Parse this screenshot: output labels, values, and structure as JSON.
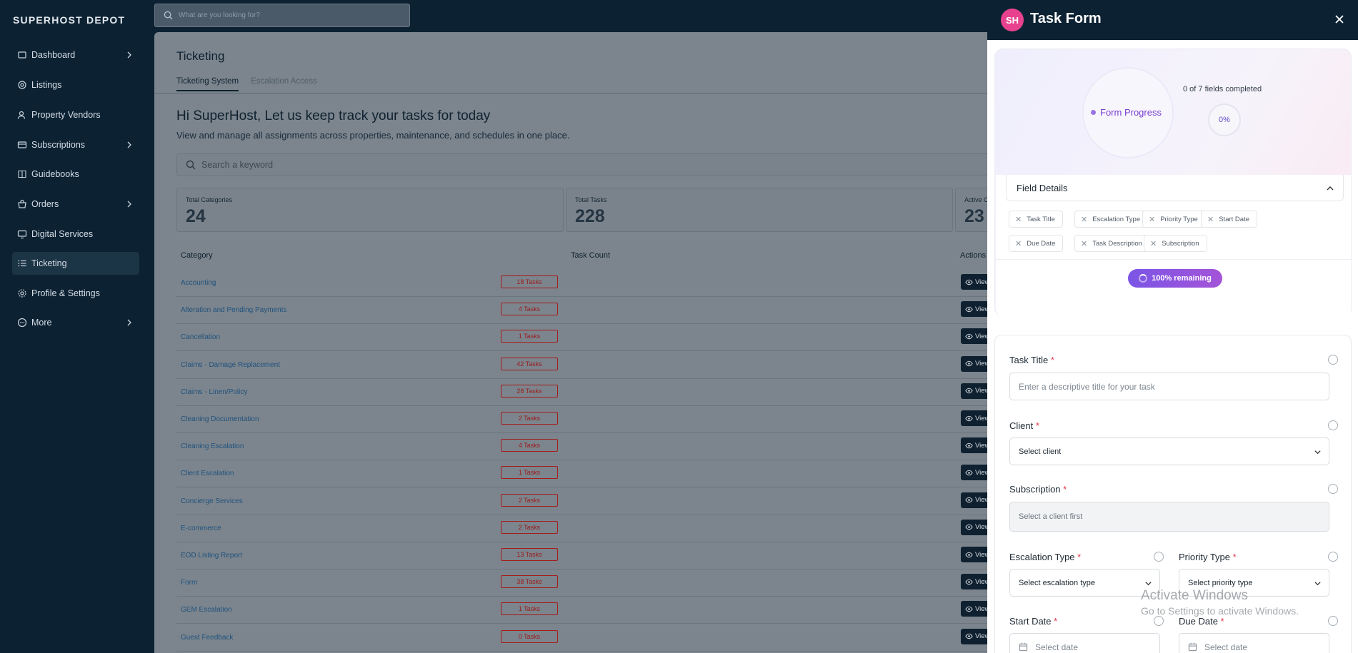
{
  "brand": "SUPERHOST DEPOT",
  "top_search": {
    "placeholder": "What are you looking for?"
  },
  "sidebar": {
    "items": [
      {
        "label": "Dashboard",
        "icon": "dashboard-icon",
        "has_chevron": true
      },
      {
        "label": "Listings",
        "icon": "listings-icon",
        "has_chevron": false
      },
      {
        "label": "Property Vendors",
        "icon": "vendors-icon",
        "has_chevron": false
      },
      {
        "label": "Subscriptions",
        "icon": "subscriptions-icon",
        "has_chevron": true
      },
      {
        "label": "Guidebooks",
        "icon": "book-icon",
        "has_chevron": false
      },
      {
        "label": "Orders",
        "icon": "orders-icon",
        "has_chevron": true
      },
      {
        "label": "Digital Services",
        "icon": "digital-icon",
        "has_chevron": false
      },
      {
        "label": "Ticketing",
        "icon": "ticketing-icon",
        "has_chevron": false,
        "active": true
      },
      {
        "label": "Profile & Settings",
        "icon": "gear-icon",
        "has_chevron": false
      },
      {
        "label": "More",
        "icon": "more-icon",
        "has_chevron": true
      }
    ]
  },
  "main": {
    "title": "Ticketing",
    "tabs": [
      "Ticketing System",
      "Escalation Access"
    ],
    "greeting": "Hi SuperHost, Let us keep track your tasks for today",
    "subtitle": "View and manage all assignments across properties, maintenance, and schedules in one place.",
    "keyword_placeholder": "Search a keyword",
    "stats": [
      {
        "label": "Total Categories",
        "value": "24"
      },
      {
        "label": "Total Tasks",
        "value": "228"
      },
      {
        "label": "Active C",
        "value": "23"
      }
    ],
    "table_headers": {
      "category": "Category",
      "count": "Task Count",
      "actions": "Actions"
    },
    "view_label": "View",
    "rows": [
      {
        "category": "Accounting",
        "count": "18 Tasks"
      },
      {
        "category": "Alteration and Pending Payments",
        "count": "4 Tasks"
      },
      {
        "category": "Cancellation",
        "count": "1 Tasks"
      },
      {
        "category": "Claims - Damage Replacement",
        "count": "42 Tasks"
      },
      {
        "category": "Claims - Linen/Policy",
        "count": "28 Tasks"
      },
      {
        "category": "Cleaning Documentation",
        "count": "2 Tasks"
      },
      {
        "category": "Cleaning Escalation",
        "count": "4 Tasks"
      },
      {
        "category": "Client Escalation",
        "count": "1 Tasks"
      },
      {
        "category": "Concierge Services",
        "count": "2 Tasks"
      },
      {
        "category": "E-commerce",
        "count": "2 Tasks"
      },
      {
        "category": "EOD Listing Report",
        "count": "13 Tasks"
      },
      {
        "category": "Form",
        "count": "38 Tasks"
      },
      {
        "category": "GEM Escalation",
        "count": "1 Tasks"
      },
      {
        "category": "Guest Feedback",
        "count": "0 Tasks"
      }
    ]
  },
  "watermark": {
    "line1": "Activate Windows",
    "line2": "Go to Settings to activate Windows."
  },
  "drawer": {
    "avatar": "SH",
    "title": "Task Form",
    "progress": {
      "label": "Form Progress",
      "fields_completed": "0 of 7 fields completed",
      "percent": "0%",
      "percent_value": 0,
      "field_details_title": "Field Details",
      "chips": [
        "Task Title",
        "Escalation Type",
        "Priority Type",
        "Start Date",
        "Due Date",
        "Task Description",
        "Subscription"
      ],
      "remaining": "100% remaining"
    },
    "form": {
      "task_title": {
        "label": "Task Title",
        "placeholder": "Enter a descriptive title for your task"
      },
      "client": {
        "label": "Client",
        "value": "Select client"
      },
      "subscription": {
        "label": "Subscription",
        "value": "Select a client first"
      },
      "escalation_type": {
        "label": "Escalation Type",
        "value": "Select escalation type"
      },
      "priority_type": {
        "label": "Priority Type",
        "value": "Select priority type"
      },
      "start_date": {
        "label": "Start Date",
        "placeholder": "Select date"
      },
      "due_date": {
        "label": "Due Date",
        "placeholder": "Select date"
      }
    },
    "required_mark": "*"
  }
}
